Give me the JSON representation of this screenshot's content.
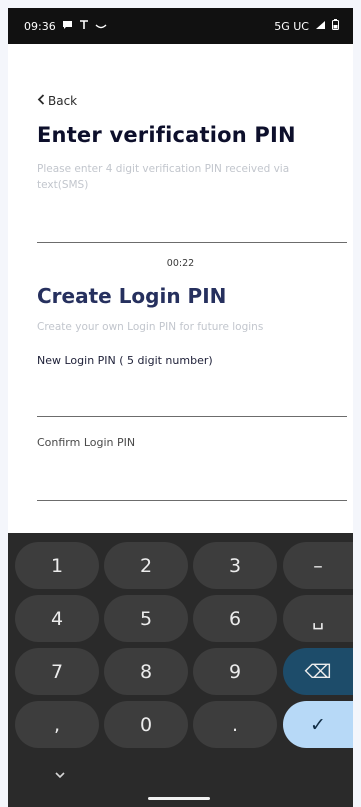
{
  "status_bar": {
    "time": "09:36",
    "network": "5G UC"
  },
  "verification": {
    "back_label": "Back",
    "title": "Enter verification PIN",
    "subtitle": "Please enter 4 digit verification PIN received via text(SMS)",
    "timer": "00:22"
  },
  "login_pin": {
    "title": "Create Login PIN",
    "subtitle": "Create your own Login PIN for future logins",
    "new_label": "New Login PIN ( 5 digit number)",
    "confirm_label": "Confirm Login PIN"
  },
  "keyboard": {
    "keys": [
      "1",
      "2",
      "3",
      "–",
      "4",
      "5",
      "6",
      "␣",
      "7",
      "8",
      "9",
      "⌫",
      ",",
      "0",
      ".",
      "✓"
    ]
  },
  "colors": {
    "title": "#0d0f2b",
    "section_title": "#26305e",
    "keyboard_bg": "#2a2a2a",
    "key_bg": "#3d3d3d",
    "done_key": "#b7d9f7",
    "delete_key": "#1d4c6a"
  },
  "icons": {
    "chat": "chat-bubble-icon",
    "antenna": "antenna-icon",
    "signal": "signal-icon",
    "battery": "battery-icon",
    "back": "chevron-left-icon",
    "keyboard_hide": "chevron-down-icon"
  }
}
